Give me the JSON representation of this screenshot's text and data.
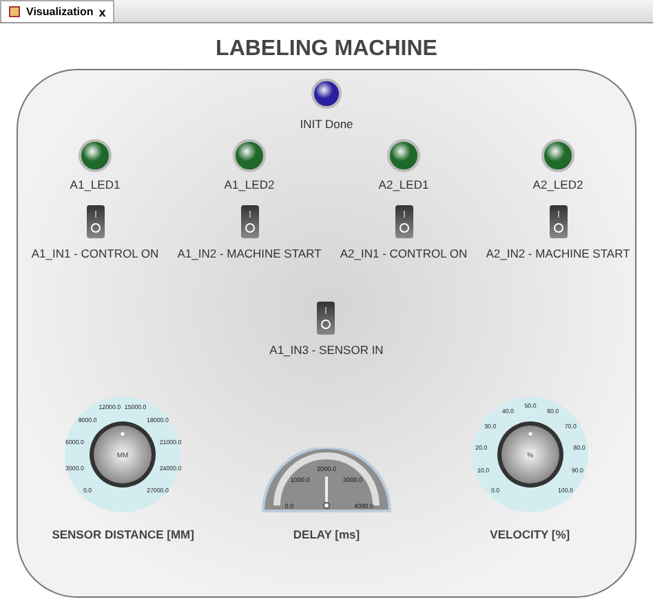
{
  "tab": {
    "label": "Visualization",
    "close": "x",
    "selected": true
  },
  "title": "LABELING MACHINE",
  "init_led": {
    "label": "INIT Done",
    "on": true,
    "color": "#2a1fa0"
  },
  "leds": [
    {
      "label": "A1_LED1",
      "on": true,
      "color": "#1f6a2a"
    },
    {
      "label": "A1_LED2",
      "on": true,
      "color": "#1f6a2a"
    },
    {
      "label": "A2_LED1",
      "on": true,
      "color": "#1f6a2a"
    },
    {
      "label": "A2_LED2",
      "on": true,
      "color": "#1f6a2a"
    }
  ],
  "switches": [
    {
      "label": "A1_IN1 - CONTROL ON",
      "on": false
    },
    {
      "label": "A1_IN2 - MACHINE START",
      "on": false
    },
    {
      "label": "A2_IN1 - CONTROL ON",
      "on": false
    },
    {
      "label": "A2_IN2 - MACHINE START",
      "on": false
    }
  ],
  "sensor_switch": {
    "label": "A1_IN3 - SENSOR IN",
    "on": false
  },
  "dials": [
    {
      "kind": "knob",
      "label": "SENSOR DISTANCE [MM]",
      "unit": "MM",
      "level": 0.5,
      "ticks": [
        "0.0",
        "3000.0",
        "6000.0",
        "9000.0",
        "12000.0",
        "15000.0",
        "18000.0",
        "21000.0",
        "24000.0",
        "27000.0"
      ]
    },
    {
      "kind": "gauge",
      "label": "DELAY [ms]",
      "level": 0.5,
      "ticks": [
        "0.0",
        "1000.0",
        "2000.0",
        "3000.0",
        "4000.0"
      ]
    },
    {
      "kind": "knob",
      "label": "VELOCITY [%]",
      "unit": "%",
      "level": 0.5,
      "ticks": [
        "0.0",
        "10.0",
        "20.0",
        "30.0",
        "40.0",
        "50.0",
        "60.0",
        "70.0",
        "80.0",
        "90.0",
        "100.0"
      ]
    }
  ]
}
